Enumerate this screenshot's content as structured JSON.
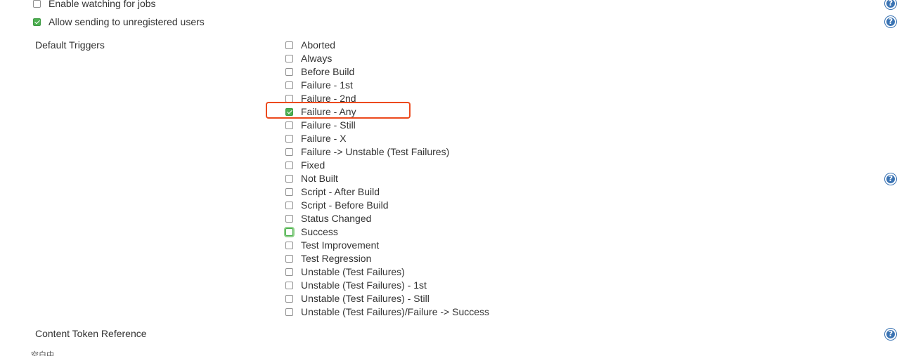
{
  "top_options": [
    {
      "label": "Enable watching for jobs",
      "checked": false
    },
    {
      "label": "Allow sending to unregistered users",
      "checked": true
    }
  ],
  "default_triggers": {
    "label": "Default Triggers",
    "items": [
      {
        "label": "Aborted",
        "checked": false
      },
      {
        "label": "Always",
        "checked": false
      },
      {
        "label": "Before Build",
        "checked": false
      },
      {
        "label": "Failure - 1st",
        "checked": false
      },
      {
        "label": "Failure - 2nd",
        "checked": false
      },
      {
        "label": "Failure - Any",
        "checked": true,
        "highlighted": true
      },
      {
        "label": "Failure - Still",
        "checked": false
      },
      {
        "label": "Failure - X",
        "checked": false
      },
      {
        "label": "Failure -> Unstable (Test Failures)",
        "checked": false
      },
      {
        "label": "Fixed",
        "checked": false
      },
      {
        "label": "Not Built",
        "checked": false
      },
      {
        "label": "Script - After Build",
        "checked": false
      },
      {
        "label": "Script - Before Build",
        "checked": false
      },
      {
        "label": "Status Changed",
        "checked": false
      },
      {
        "label": "Success",
        "checked": false,
        "focused": true
      },
      {
        "label": "Test Improvement",
        "checked": false
      },
      {
        "label": "Test Regression",
        "checked": false
      },
      {
        "label": "Unstable (Test Failures)",
        "checked": false
      },
      {
        "label": "Unstable (Test Failures) - 1st",
        "checked": false
      },
      {
        "label": "Unstable (Test Failures) - Still",
        "checked": false
      },
      {
        "label": "Unstable (Test Failures)/Failure -> Success",
        "checked": false
      }
    ]
  },
  "content_token_reference": {
    "label": "Content Token Reference"
  },
  "help_icon": {
    "glyph": "?",
    "icon": "help-icon"
  },
  "colors": {
    "highlight": "#ec4a1d",
    "checked": "#4caf50",
    "help": "#3a73b3"
  },
  "truncated_text": "空白中"
}
